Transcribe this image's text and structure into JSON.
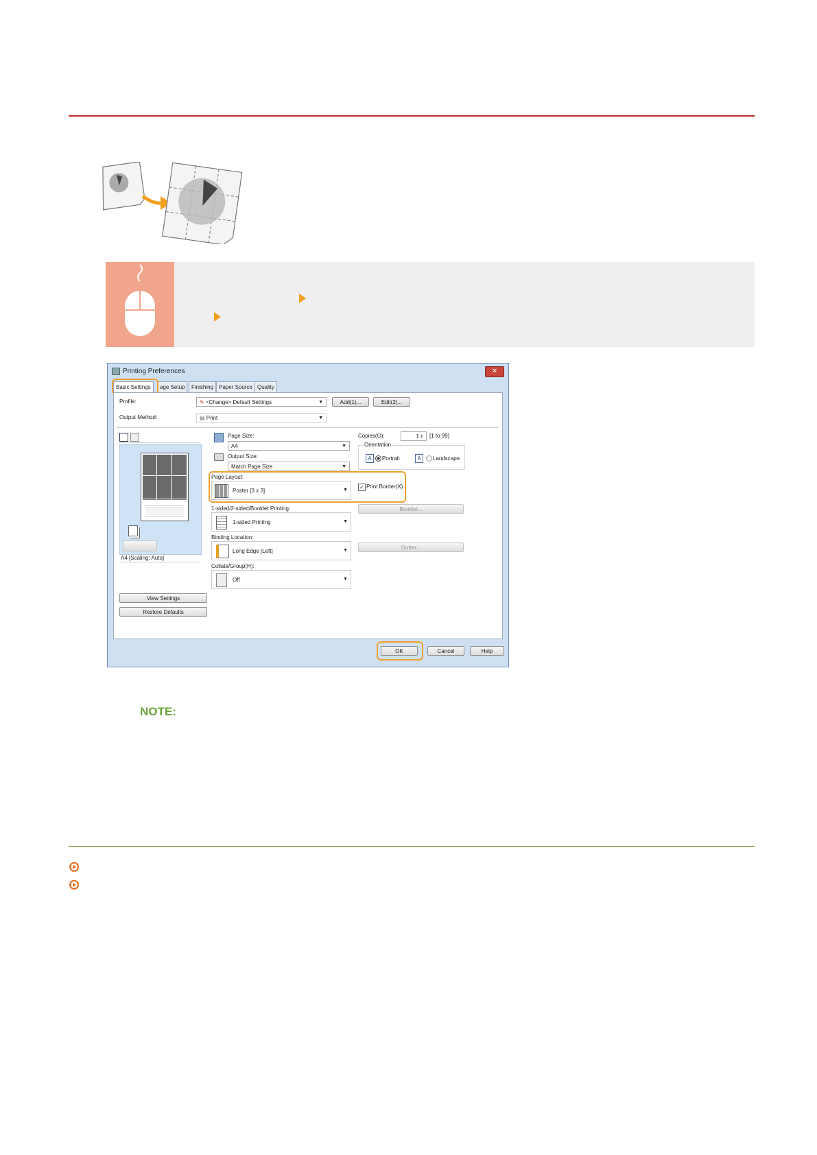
{
  "dialog": {
    "title": "Printing Preferences",
    "close_label": "✕",
    "tabs": [
      "Basic Settings",
      "age Setup",
      "Finishing",
      "Paper Source",
      "Quality"
    ],
    "profile_label": "Profile:",
    "profile_value": "<Change> Default Settings",
    "add_button": "Add(1)...",
    "edit_button": "Edit(2)...",
    "output_method_label": "Output Method:",
    "output_method_value": "Print",
    "page_size_label": "Page Size:",
    "page_size_value": "A4",
    "output_size_label": "Output Size:",
    "output_size_value": "Match Page Size",
    "copies_label": "Copies(G):",
    "copies_value": "1",
    "copies_range": "[1 to 99]",
    "orientation_label": "Orientation",
    "portrait_label": "Portrait",
    "landscape_label": "Landscape",
    "page_layout_label": "Page Layout:",
    "page_layout_value": "Poster [3 x 3]",
    "print_border_label": "Print Border(X)",
    "sided_label": "1-sided/2-sided/Booklet Printing:",
    "sided_value": "1-sided Printing",
    "booklet_button": "Booklet...",
    "binding_label": "Binding Location:",
    "binding_value": "Long Edge [Left]",
    "gutter_button": "Gutter...",
    "collate_label": "Collate/Group(H):",
    "collate_value": "Off",
    "preview_caption": "A4 [Scaling: Auto]",
    "view_settings_button": "View Settings",
    "restore_defaults_button": "Restore Defaults",
    "ok_button": "OK",
    "cancel_button": "Cancel",
    "help_button": "Help"
  },
  "note": {
    "label": "NOTE:"
  },
  "colors": {
    "rule_red": "#c0272d",
    "rule_green": "#6f8f3e",
    "highlight": "#f0a030",
    "note_green": "#6aa33a",
    "banner_icon": "#f1a58c"
  }
}
